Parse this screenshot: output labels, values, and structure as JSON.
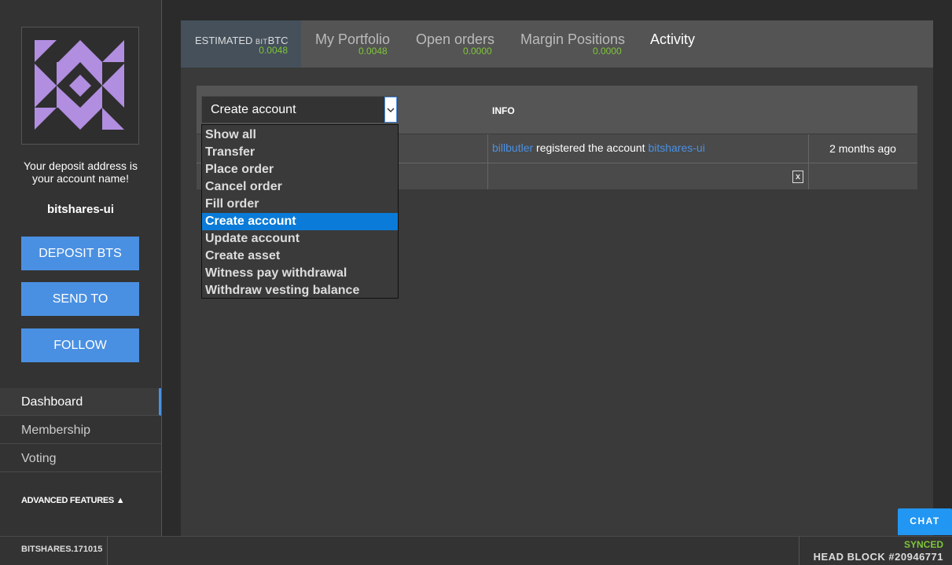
{
  "sidebar": {
    "deposit_note_line1": "Your deposit address is",
    "deposit_note_line2": "your account name!",
    "account_name": "bitshares-ui",
    "buttons": {
      "deposit": "DEPOSIT BTS",
      "send": "SEND TO",
      "follow": "FOLLOW"
    },
    "nav": [
      "Dashboard",
      "Membership",
      "Voting"
    ],
    "active_nav": "Dashboard",
    "advanced_label": "ADVANCED FEATURES ▲"
  },
  "tabs": {
    "estimated_label_main": "ESTIMATED ",
    "estimated_label_small": "BIT",
    "estimated_label_unit": "BTC",
    "estimated_value": "0.0048",
    "items": [
      {
        "label": "My Portfolio",
        "value": "0.0048"
      },
      {
        "label": "Open orders",
        "value": "0.0000"
      },
      {
        "label": "Margin Positions",
        "value": "0.0000"
      },
      {
        "label": "Activity",
        "value": ""
      }
    ],
    "active": "Activity"
  },
  "table": {
    "info_header": "INFO",
    "rows": [
      {
        "user": "billbutler",
        "action": " registered the account ",
        "account": "bitshares-ui",
        "time": "2 months ago"
      }
    ],
    "export_icon": "excel-icon"
  },
  "filter": {
    "selected": "Create account",
    "options": [
      "Show all",
      "Transfer",
      "Place order",
      "Cancel order",
      "Fill order",
      "Create account",
      "Update account",
      "Create asset",
      "Witness pay withdrawal",
      "Withdraw vesting balance"
    ]
  },
  "footer": {
    "version": "BITSHARES.171015",
    "synced": "SYNCED",
    "head_block": "HEAD BLOCK #20946771",
    "chat": "CHAT"
  },
  "colors": {
    "accent": "#4a90e2",
    "positive": "#7ec638",
    "selected_option": "#0a7bd8",
    "identicon": "#b18ee0"
  }
}
